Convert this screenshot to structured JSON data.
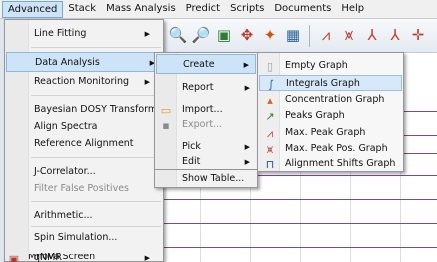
{
  "menubar": {
    "items": [
      "Advanced",
      "Stack",
      "Mass Analysis",
      "Predict",
      "Scripts",
      "Documents",
      "Help"
    ]
  },
  "advanced_menu": {
    "items": [
      {
        "label": "Line Fitting",
        "submenu": true
      },
      {
        "label": "Data Analysis",
        "submenu": true
      },
      {
        "label": "Reaction Monitoring",
        "submenu": true
      },
      {
        "label": "Bayesian DOSY Transform..."
      },
      {
        "label": "Align Spectra"
      },
      {
        "label": "Reference Alignment"
      },
      {
        "label": "J-Correlator..."
      },
      {
        "label": "Filter False Positives",
        "disabled": true
      },
      {
        "label": "Arithmetic..."
      },
      {
        "label": "Spin Simulation..."
      },
      {
        "label": "qNMR",
        "submenu": true
      },
      {
        "label": "Mnova Screen"
      }
    ]
  },
  "data_analysis_menu": {
    "items": [
      {
        "label": "Create",
        "submenu": true
      },
      {
        "label": "Report",
        "submenu": true
      },
      {
        "label": "Import..."
      },
      {
        "label": "Export...",
        "disabled": true
      },
      {
        "label": "Pick",
        "submenu": true
      },
      {
        "label": "Edit",
        "submenu": true
      },
      {
        "label": "Show Table..."
      }
    ]
  },
  "create_menu": {
    "items": [
      {
        "label": "Empty Graph",
        "icon": "empty-graph-icon"
      },
      {
        "label": "Integrals Graph",
        "icon": "integrals-graph-icon"
      },
      {
        "label": "Concentration Graph",
        "icon": "concentration-graph-icon"
      },
      {
        "label": "Peaks Graph",
        "icon": "peaks-graph-icon"
      },
      {
        "label": "Max. Peak Graph",
        "icon": "max-peak-graph-icon"
      },
      {
        "label": "Max. Peak Pos. Graph",
        "icon": "max-peak-pos-graph-icon"
      },
      {
        "label": "Alignment Shifts Graph",
        "icon": "alignment-shifts-graph-icon"
      }
    ]
  },
  "colors": {
    "highlight": "#cde3f7",
    "spectrum_lines": "#7a4a8c"
  }
}
